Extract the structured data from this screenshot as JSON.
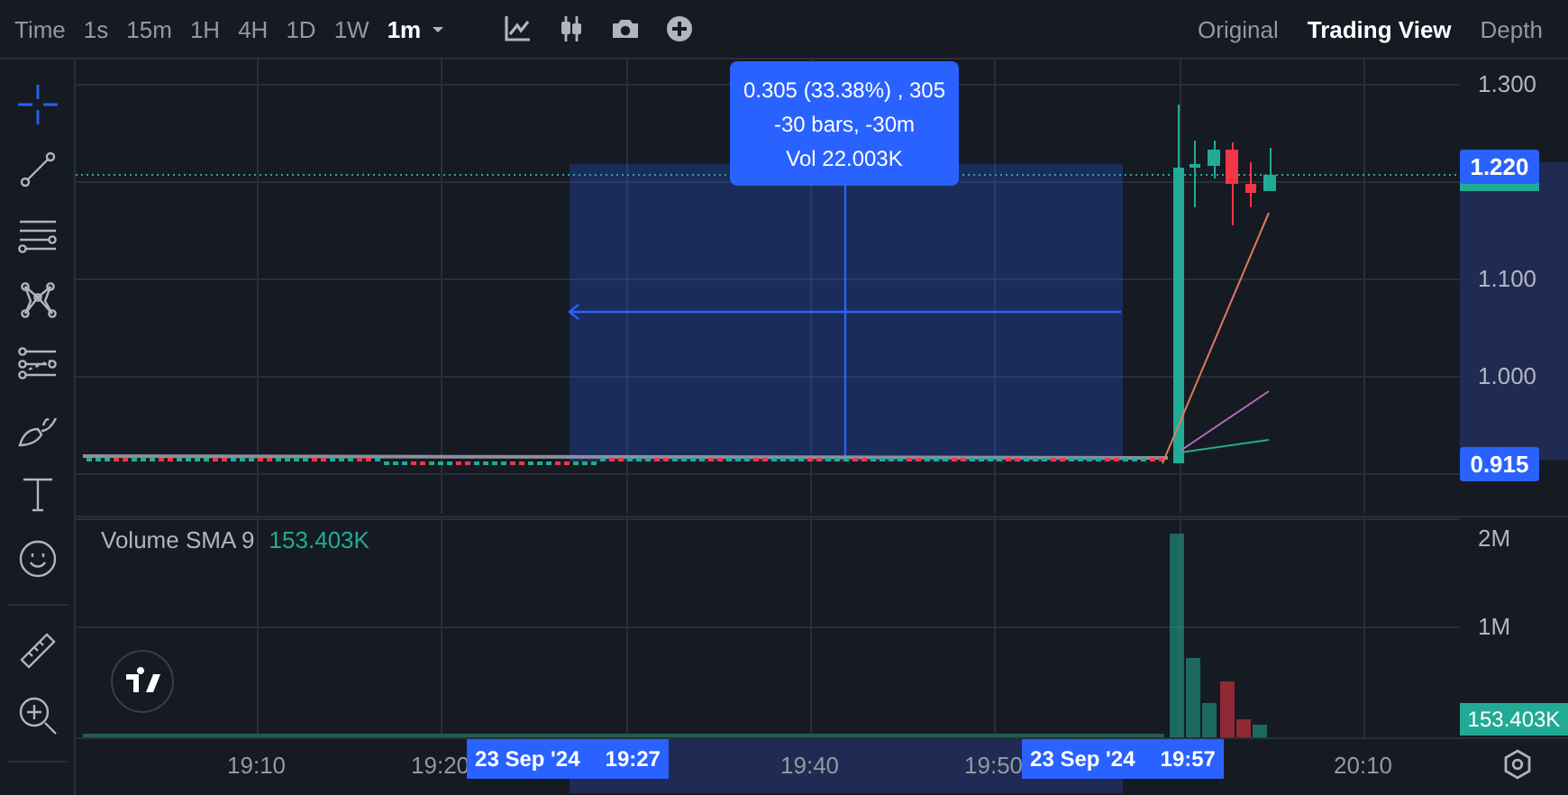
{
  "toolbar": {
    "intervals": [
      {
        "label": "Time",
        "selected": false
      },
      {
        "label": "1s",
        "selected": false
      },
      {
        "label": "15m",
        "selected": false
      },
      {
        "label": "1H",
        "selected": false
      },
      {
        "label": "4H",
        "selected": false
      },
      {
        "label": "1D",
        "selected": false
      },
      {
        "label": "1W",
        "selected": false
      },
      {
        "label": "1m",
        "selected": true
      }
    ],
    "tools": [
      {
        "kind": "indicators"
      },
      {
        "kind": "candles"
      },
      {
        "kind": "camera"
      },
      {
        "kind": "add"
      }
    ],
    "views": [
      {
        "label": "Original",
        "selected": false
      },
      {
        "label": "Trading View",
        "selected": true
      },
      {
        "label": "Depth",
        "selected": false
      }
    ]
  },
  "drawing_tools": [
    {
      "kind": "crosshair",
      "selected": true
    },
    {
      "kind": "trendline",
      "selected": false
    },
    {
      "kind": "lines",
      "selected": false
    },
    {
      "kind": "pattern",
      "selected": false
    },
    {
      "kind": "forecast",
      "selected": false
    },
    {
      "kind": "brush",
      "selected": false
    },
    {
      "kind": "text",
      "selected": false
    },
    {
      "kind": "emoji",
      "selected": false
    },
    {
      "kind": "ruler",
      "selected": false
    },
    {
      "kind": "zoom",
      "selected": false
    }
  ],
  "price_pane": {
    "ticks": [
      "1.300",
      "1.100",
      "1.000"
    ],
    "last_price": "1.220",
    "range_low": "0.915",
    "measure": [
      "0.305 (33.38%) , 305",
      "-30 bars, -30m",
      "Vol 22.003K"
    ]
  },
  "volume_pane": {
    "legend": {
      "name": "Volume SMA 9",
      "value": "153.403K"
    },
    "ticks": [
      "2M",
      "1M"
    ],
    "last_value": "153.403K"
  },
  "time_axis": {
    "ticks": [
      "19:10",
      "19:20",
      "19:40",
      "19:50",
      "20:10"
    ],
    "range_labels": [
      {
        "date": "23 Sep '24",
        "time": "19:27"
      },
      {
        "date": "23 Sep '24",
        "time": "19:57"
      }
    ]
  }
}
